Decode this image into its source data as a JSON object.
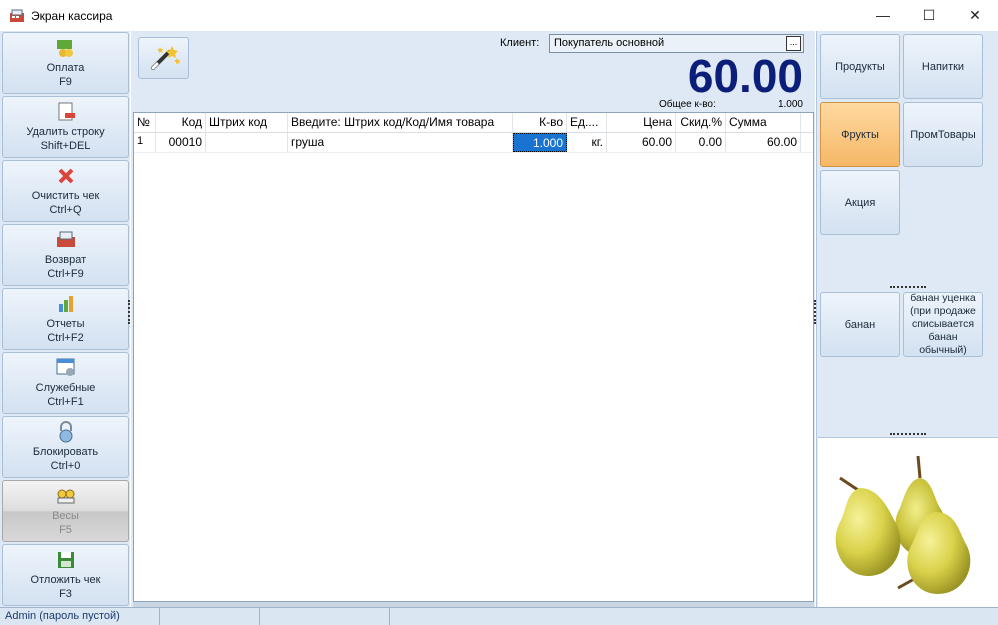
{
  "window": {
    "title": "Экран кассира",
    "minimize": "—",
    "maximize": "☐",
    "close": "✕"
  },
  "left_buttons": [
    {
      "label": "Оплата",
      "hotkey": "F9",
      "icon": "cash-icon"
    },
    {
      "label": "Удалить строку",
      "hotkey": "Shift+DEL",
      "icon": "delete-row-icon"
    },
    {
      "label": "Очистить чек",
      "hotkey": "Ctrl+Q",
      "icon": "clear-icon"
    },
    {
      "label": "Возврат",
      "hotkey": "Ctrl+F9",
      "icon": "return-icon"
    },
    {
      "label": "Отчеты",
      "hotkey": "Ctrl+F2",
      "icon": "reports-icon"
    },
    {
      "label": "Служебные",
      "hotkey": "Ctrl+F1",
      "icon": "service-icon"
    },
    {
      "label": "Блокировать",
      "hotkey": "Ctrl+0",
      "icon": "lock-icon"
    },
    {
      "label": "Весы",
      "hotkey": "F5",
      "icon": "scales-icon",
      "disabled": true
    },
    {
      "label": "Отложить чек",
      "hotkey": "F3",
      "icon": "save-icon"
    }
  ],
  "header": {
    "client_label": "Клиент:",
    "client_value": "Покупатель основной",
    "client_browse": "...",
    "total": "60.00",
    "qty_label": "Общее к-во:",
    "qty_value": "1.000"
  },
  "table": {
    "columns": [
      "№",
      "Код",
      "Штрих код",
      "Введите: Штрих код/Код/Имя товара",
      "К-во",
      "Ед....",
      "Цена",
      "Скид.%",
      "Сумма"
    ],
    "rows": [
      {
        "no": "1",
        "code": "00010",
        "barcode": "",
        "name": "груша",
        "qty": "1.000",
        "unit": "кг.",
        "price": "60.00",
        "discount": "0.00",
        "sum": "60.00"
      }
    ]
  },
  "categories": [
    {
      "label": "Продукты",
      "active": false
    },
    {
      "label": "Напитки",
      "active": false
    },
    {
      "label": "Фрукты",
      "active": true
    },
    {
      "label": "ПромТовары",
      "active": false
    },
    {
      "label": "Акция",
      "active": false
    }
  ],
  "products": [
    {
      "label": "банан"
    },
    {
      "label": "банан уценка (при продаже списывается банан обычный)"
    }
  ],
  "statusbar": {
    "user": "Admin (пароль пустой)"
  },
  "colors": {
    "total": "#0b1e7a",
    "active_category": "#f5b867",
    "selected_cell": "#1874d0"
  }
}
